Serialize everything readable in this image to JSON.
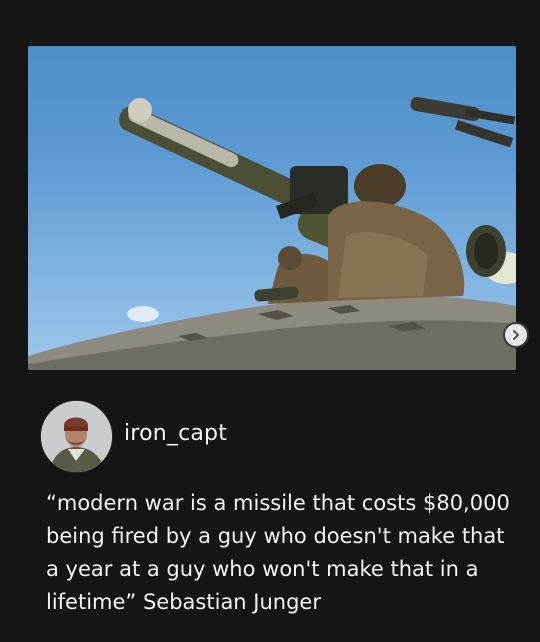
{
  "post": {
    "image_alt": "soldiers firing missile launcher",
    "next_icon": "chevron-right-icon",
    "author": {
      "username": "iron_capt",
      "avatar_icon": "profile-photo"
    },
    "caption": "“modern war is a missile that costs $80,000\nbeing fired by a guy who doesn't make that\na year at a guy who won't make that in a\nlifetime” Sebastian Junger"
  },
  "colors": {
    "background": "#151515",
    "text": "#f4f4f4",
    "sky": "#5d9ad3"
  }
}
